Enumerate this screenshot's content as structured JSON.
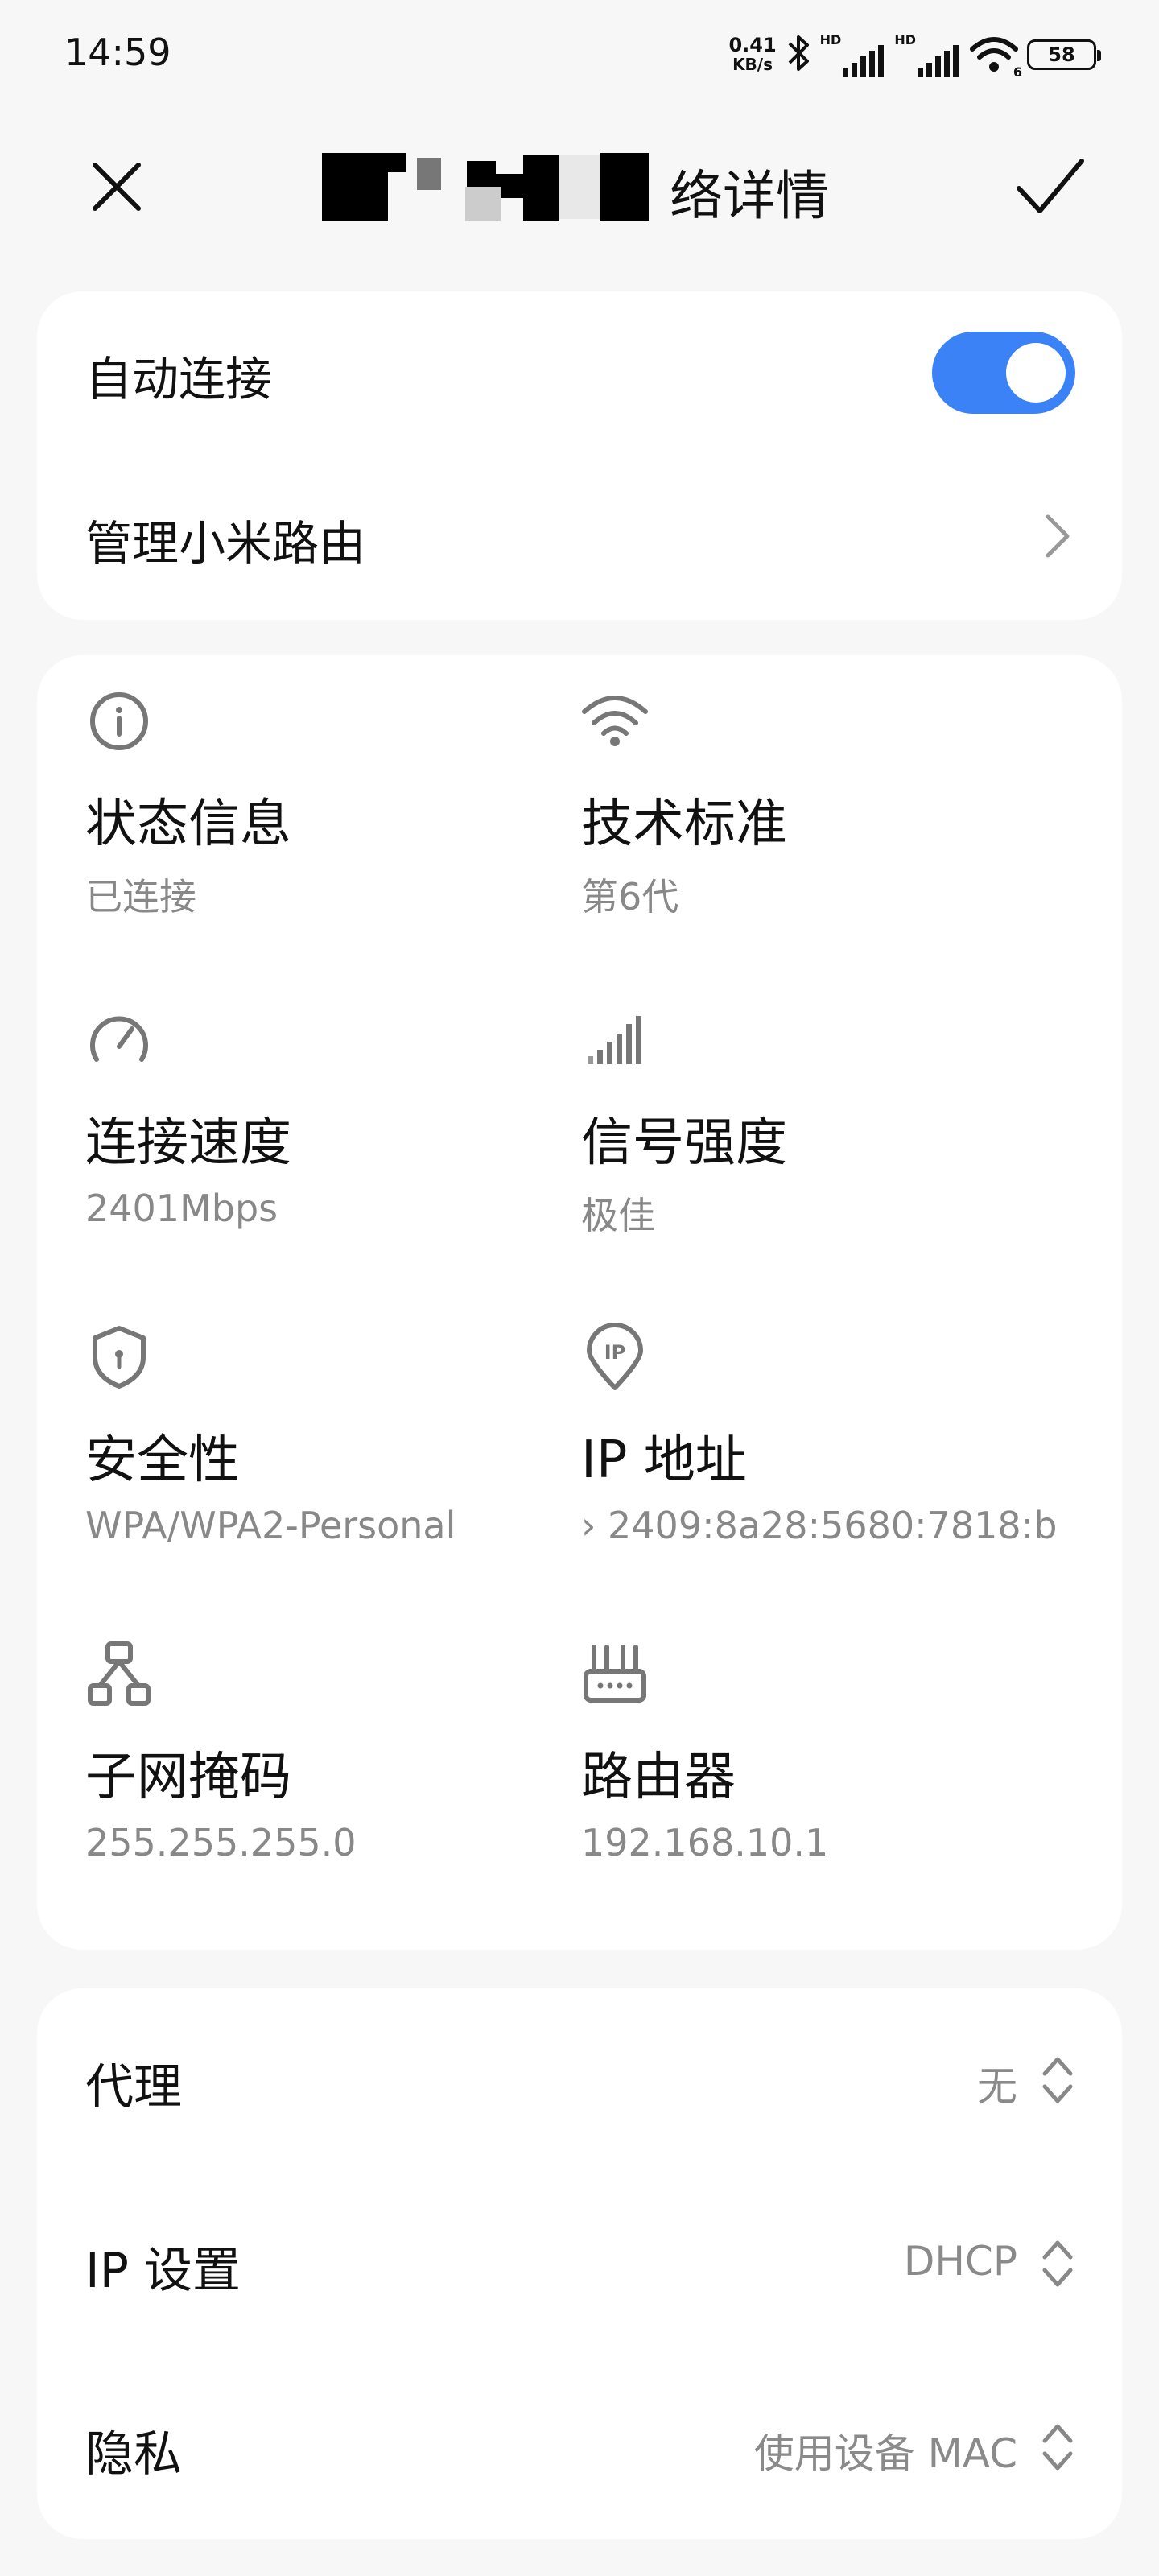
{
  "status_bar": {
    "time": "14:59",
    "net_speed_value": "0.41",
    "net_speed_unit": "KB/s",
    "hd_label_1": "HD",
    "hd_label_2": "HD",
    "wifi_generation": "6",
    "battery": "58"
  },
  "title_bar": {
    "title_visible_tail": "络详情"
  },
  "auto_card": {
    "auto_connect_label": "自动连接",
    "auto_connect_on": true,
    "manage_router_label": "管理小米路由"
  },
  "info_grid": [
    {
      "label": "状态信息",
      "value": "已连接",
      "icon": "info-icon"
    },
    {
      "label": "技术标准",
      "value": "第6代",
      "icon": "wifi-icon"
    },
    {
      "label": "连接速度",
      "value": "2401Mbps",
      "icon": "speedometer-icon"
    },
    {
      "label": "信号强度",
      "value": "极佳",
      "icon": "signal-bars-icon"
    },
    {
      "label": "安全性",
      "value": "WPA/WPA2-Personal",
      "icon": "shield-icon"
    },
    {
      "label": "IP 地址",
      "value": "› 2409:8a28:5680:7818:b",
      "icon": "ip-location-icon"
    },
    {
      "label": "子网掩码",
      "value": "255.255.255.0",
      "icon": "network-topology-icon"
    },
    {
      "label": "路由器",
      "value": "192.168.10.1",
      "icon": "router-icon"
    }
  ],
  "settings": [
    {
      "label": "代理",
      "value": "无"
    },
    {
      "label": "IP 设置",
      "value": "DHCP"
    },
    {
      "label": "隐私",
      "value": "使用设备 MAC"
    }
  ],
  "colors": {
    "accent": "#3a82f6",
    "background": "#f7f7f7",
    "card": "#ffffff",
    "secondary_text": "#888888"
  }
}
